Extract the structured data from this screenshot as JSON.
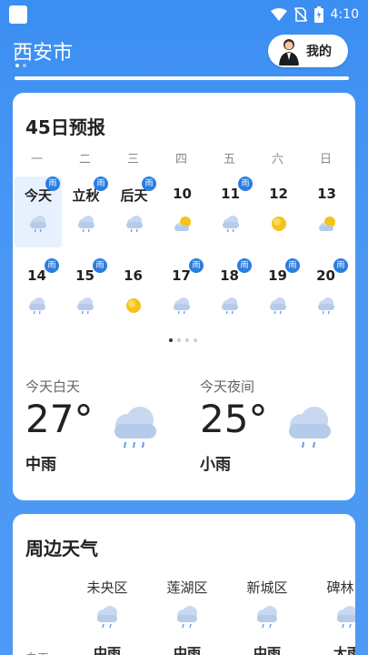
{
  "status": {
    "time": "4:10"
  },
  "header": {
    "city": "西安市",
    "mine_label": "我的"
  },
  "forecast": {
    "title": "45日预报",
    "weekdays": [
      "一",
      "二",
      "三",
      "四",
      "五",
      "六",
      "日"
    ],
    "rows": [
      [
        {
          "label": "今天",
          "badge": "雨",
          "icon": "rain-cloud-icon"
        },
        {
          "label": "立秋",
          "badge": "雨",
          "icon": "rain-cloud-icon"
        },
        {
          "label": "后天",
          "badge": "雨",
          "icon": "rain-cloud-icon"
        },
        {
          "label": "10",
          "badge": "",
          "icon": "partly-sunny-icon"
        },
        {
          "label": "11",
          "badge": "雨",
          "icon": "rain-cloud-icon"
        },
        {
          "label": "12",
          "badge": "",
          "icon": "sun-icon"
        },
        {
          "label": "13",
          "badge": "",
          "icon": "partly-sunny-icon"
        }
      ],
      [
        {
          "label": "14",
          "badge": "雨",
          "icon": "rain-cloud-icon"
        },
        {
          "label": "15",
          "badge": "雨",
          "icon": "rain-cloud-icon"
        },
        {
          "label": "16",
          "badge": "",
          "icon": "sun-icon"
        },
        {
          "label": "17",
          "badge": "雨",
          "icon": "rain-cloud-icon"
        },
        {
          "label": "18",
          "badge": "雨",
          "icon": "rain-cloud-icon"
        },
        {
          "label": "19",
          "badge": "雨",
          "icon": "rain-cloud-icon"
        },
        {
          "label": "20",
          "badge": "雨",
          "icon": "rain-cloud-icon"
        }
      ]
    ],
    "today_day": {
      "label": "今天白天",
      "temp": "27°",
      "desc": "中雨"
    },
    "today_night": {
      "label": "今天夜间",
      "temp": "25°",
      "desc": "小雨"
    }
  },
  "around": {
    "title": "周边天气",
    "row_label": "白天",
    "districts": [
      {
        "name": "未央区",
        "desc": "中雨"
      },
      {
        "name": "莲湖区",
        "desc": "中雨"
      },
      {
        "name": "新城区",
        "desc": "中雨"
      },
      {
        "name": "碑林区",
        "desc": "大雨"
      }
    ]
  },
  "colors": {
    "background": "#4a98f4",
    "accent": "#2a7de1",
    "sun": "#f5c21b",
    "cloud": "#b9cdea"
  }
}
